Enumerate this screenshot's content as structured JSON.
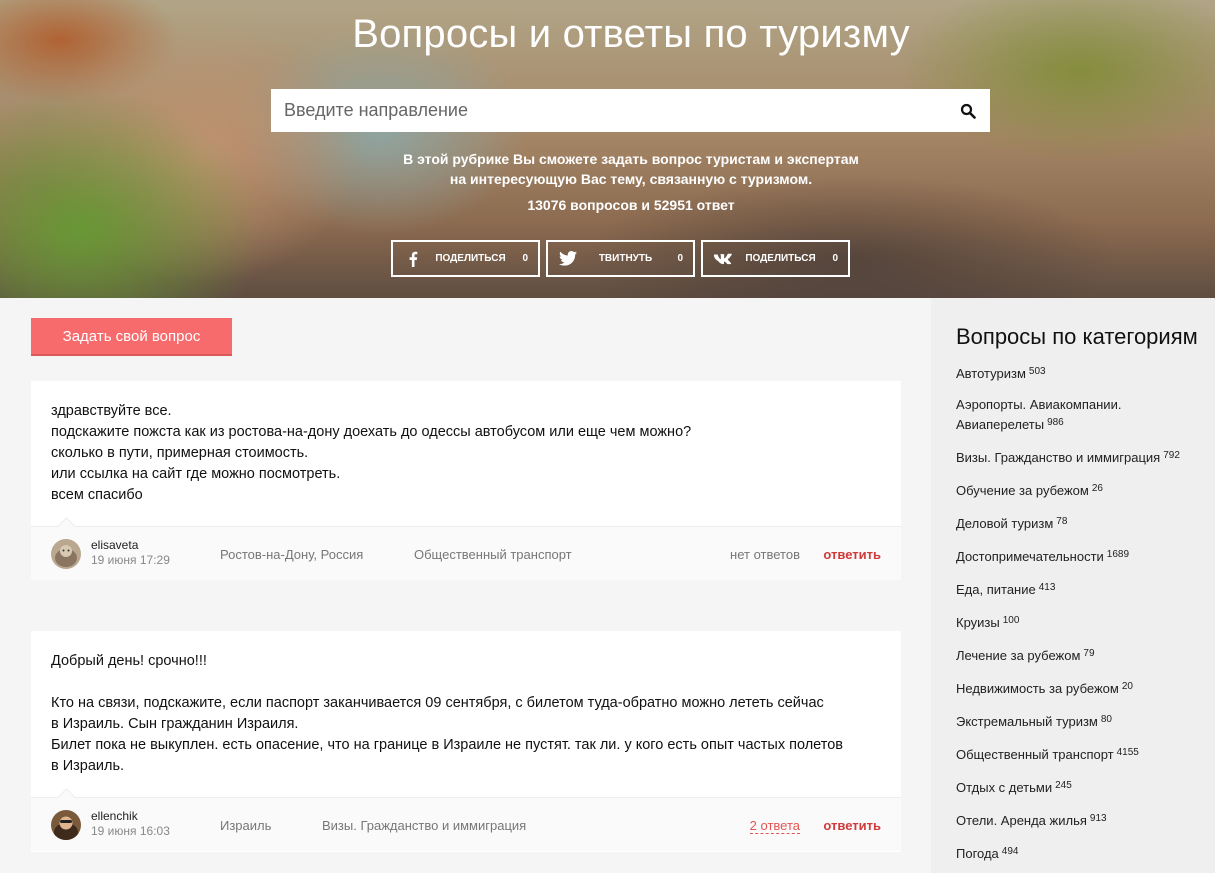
{
  "hero": {
    "title": "Вопросы и ответы по туризму",
    "search_placeholder": "Введите направление",
    "text_line1": "В этой рубрике Вы сможете задать вопрос туристам и экспертам",
    "text_line2": "на интересующую Вас тему, связанную с туризмом.",
    "stats": "13076 вопросов и 52951 ответ",
    "shares": [
      {
        "icon": "facebook-icon",
        "label": "ПОДЕЛИТЬСЯ",
        "count": "0"
      },
      {
        "icon": "twitter-icon",
        "label": "ТВИТНУТЬ",
        "count": "0"
      },
      {
        "icon": "vk-icon",
        "label": "ПОДЕЛИТЬСЯ",
        "count": "0"
      }
    ]
  },
  "ask_button": "Задать свой вопрос",
  "questions": [
    {
      "lines": [
        "здравствуйте все.",
        "подскажите пожста как из ростова-на-дону доехать до одессы автобусом или еще чем можно?",
        "сколько в пути, примерная стоимость.",
        "или ссылка на сайт где можно посмотреть.",
        "всем спасибо"
      ],
      "author": "elisaveta",
      "date": "19 июня 17:29",
      "location": "Ростов-на-Дону, Россия",
      "category": "Общественный транспорт",
      "answers": "нет ответов",
      "reply": "ответить"
    },
    {
      "lines": [
        "Добрый день! срочно!!!",
        "",
        "Кто на связи, подскажите, если паспорт заканчивается 09 сентября, с билетом туда-обратно можно лететь сейчас",
        "в Израиль. Сын гражданин Израиля.",
        "Билет пока не выкуплен. есть опасение, что на границе в Израиле не пустят. так ли. у кого есть опыт частых полетов",
        "в Израиль."
      ],
      "author": "ellenchik",
      "date": "19 июня 16:03",
      "location": "Израиль",
      "category": "Визы. Гражданство и иммиграция",
      "answers": "2 ответа",
      "reply": "ответить"
    }
  ],
  "sidebar": {
    "title": "Вопросы по категориям",
    "categories": [
      {
        "name": "Автотуризм",
        "count": "503"
      },
      {
        "name": "Аэропорты. Авиакомпании. Авиаперелеты",
        "count": "986"
      },
      {
        "name": "Визы. Гражданство и иммиграция",
        "count": "792"
      },
      {
        "name": "Обучение за рубежом",
        "count": "26"
      },
      {
        "name": "Деловой туризм",
        "count": "78"
      },
      {
        "name": "Достопримечательности",
        "count": "1689"
      },
      {
        "name": "Еда, питание",
        "count": "413"
      },
      {
        "name": "Круизы",
        "count": "100"
      },
      {
        "name": "Лечение за рубежом",
        "count": "79"
      },
      {
        "name": "Недвижимость за рубежом",
        "count": "20"
      },
      {
        "name": "Экстремальный туризм",
        "count": "80"
      },
      {
        "name": "Общественный транспорт",
        "count": "4155"
      },
      {
        "name": "Отдых с детьми",
        "count": "245"
      },
      {
        "name": "Отели. Аренда жилья",
        "count": "913"
      },
      {
        "name": "Погода",
        "count": "494"
      }
    ]
  }
}
